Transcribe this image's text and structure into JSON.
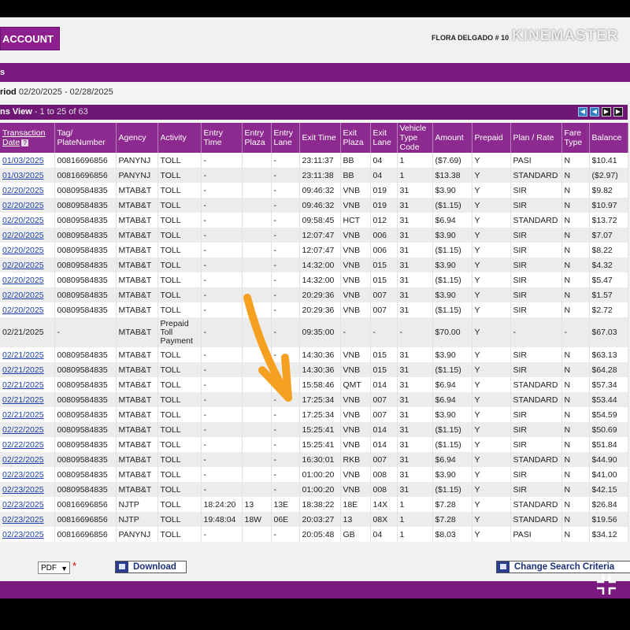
{
  "header": {
    "account_button": "ACCOUNT",
    "user": "FLORA DELGADO # 10",
    "watermark": "KINEMASTER",
    "section_title": "s",
    "period_label": "riod",
    "period_value": "02/20/2025 - 02/28/2025",
    "view_title": "ns View",
    "view_count": "- 1 to 25 of 63"
  },
  "pager_icons": [
    "first-page-icon",
    "previous-page-icon",
    "next-page-icon",
    "last-page-icon"
  ],
  "columns": [
    "Transaction Date",
    "Tag/ PlateNumber",
    "Agency",
    "Activity",
    "Entry Time",
    "Entry Plaza",
    "Entry Lane",
    "Exit Time",
    "Exit Plaza",
    "Exit Lane",
    "Vehicle Type Code",
    "Amount",
    "Prepaid",
    "Plan / Rate",
    "Fare Type",
    "Balance"
  ],
  "rows": [
    [
      "01/03/2025",
      "00816696856",
      "PANYNJ",
      "TOLL",
      "-",
      "",
      "-",
      "23:11:37",
      "BB",
      "04",
      "1",
      "($7.69)",
      "Y",
      "PASI",
      "N",
      "$10.41"
    ],
    [
      "01/03/2025",
      "00816696856",
      "PANYNJ",
      "TOLL",
      "-",
      "",
      "-",
      "23:11:38",
      "BB",
      "04",
      "1",
      "$13.38",
      "Y",
      "STANDARD",
      "N",
      "($2.97)"
    ],
    [
      "02/20/2025",
      "00809584835",
      "MTAB&T",
      "TOLL",
      "-",
      "",
      "-",
      "09:46:32",
      "VNB",
      "019",
      "31",
      "$3.90",
      "Y",
      "SIR",
      "N",
      "$9.82"
    ],
    [
      "02/20/2025",
      "00809584835",
      "MTAB&T",
      "TOLL",
      "-",
      "",
      "-",
      "09:46:32",
      "VNB",
      "019",
      "31",
      "($1.15)",
      "Y",
      "SIR",
      "N",
      "$10.97"
    ],
    [
      "02/20/2025",
      "00809584835",
      "MTAB&T",
      "TOLL",
      "-",
      "",
      "-",
      "09:58:45",
      "HCT",
      "012",
      "31",
      "$6.94",
      "Y",
      "STANDARD",
      "N",
      "$13.72"
    ],
    [
      "02/20/2025",
      "00809584835",
      "MTAB&T",
      "TOLL",
      "-",
      "",
      "-",
      "12:07:47",
      "VNB",
      "006",
      "31",
      "$3.90",
      "Y",
      "SIR",
      "N",
      "$7.07"
    ],
    [
      "02/20/2025",
      "00809584835",
      "MTAB&T",
      "TOLL",
      "-",
      "",
      "-",
      "12:07:47",
      "VNB",
      "006",
      "31",
      "($1.15)",
      "Y",
      "SIR",
      "N",
      "$8.22"
    ],
    [
      "02/20/2025",
      "00809584835",
      "MTAB&T",
      "TOLL",
      "-",
      "",
      "-",
      "14:32:00",
      "VNB",
      "015",
      "31",
      "$3.90",
      "Y",
      "SIR",
      "N",
      "$4.32"
    ],
    [
      "02/20/2025",
      "00809584835",
      "MTAB&T",
      "TOLL",
      "-",
      "",
      "-",
      "14:32:00",
      "VNB",
      "015",
      "31",
      "($1.15)",
      "Y",
      "SIR",
      "N",
      "$5.47"
    ],
    [
      "02/20/2025",
      "00809584835",
      "MTAB&T",
      "TOLL",
      "-",
      "",
      "-",
      "20:29:36",
      "VNB",
      "007",
      "31",
      "$3.90",
      "Y",
      "SIR",
      "N",
      "$1.57"
    ],
    [
      "02/20/2025",
      "00809584835",
      "MTAB&T",
      "TOLL",
      "-",
      "",
      "-",
      "20:29:36",
      "VNB",
      "007",
      "31",
      "($1.15)",
      "Y",
      "SIR",
      "N",
      "$2.72"
    ],
    [
      "02/21/2025",
      "-",
      "MTAB&T",
      "Prepaid Toll Payment",
      "-",
      "",
      "-",
      "09:35:00",
      "-",
      "-",
      "-",
      "$70.00",
      "Y",
      "-",
      "-",
      "$67.03"
    ],
    [
      "02/21/2025",
      "00809584835",
      "MTAB&T",
      "TOLL",
      "-",
      "",
      "-",
      "14:30:36",
      "VNB",
      "015",
      "31",
      "$3.90",
      "Y",
      "SIR",
      "N",
      "$63.13"
    ],
    [
      "02/21/2025",
      "00809584835",
      "MTAB&T",
      "TOLL",
      "-",
      "",
      "-",
      "14:30:36",
      "VNB",
      "015",
      "31",
      "($1.15)",
      "Y",
      "SIR",
      "N",
      "$64.28"
    ],
    [
      "02/21/2025",
      "00809584835",
      "MTAB&T",
      "TOLL",
      "-",
      "",
      "-",
      "15:58:46",
      "QMT",
      "014",
      "31",
      "$6.94",
      "Y",
      "STANDARD",
      "N",
      "$57.34"
    ],
    [
      "02/21/2025",
      "00809584835",
      "MTAB&T",
      "TOLL",
      "-",
      "",
      "-",
      "17:25:34",
      "VNB",
      "007",
      "31",
      "$6.94",
      "Y",
      "STANDARD",
      "N",
      "$53.44"
    ],
    [
      "02/21/2025",
      "00809584835",
      "MTAB&T",
      "TOLL",
      "-",
      "",
      "-",
      "17:25:34",
      "VNB",
      "007",
      "31",
      "$3.90",
      "Y",
      "SIR",
      "N",
      "$54.59"
    ],
    [
      "02/22/2025",
      "00809584835",
      "MTAB&T",
      "TOLL",
      "-",
      "",
      "-",
      "15:25:41",
      "VNB",
      "014",
      "31",
      "($1.15)",
      "Y",
      "SIR",
      "N",
      "$50.69"
    ],
    [
      "02/22/2025",
      "00809584835",
      "MTAB&T",
      "TOLL",
      "-",
      "",
      "-",
      "15:25:41",
      "VNB",
      "014",
      "31",
      "($1.15)",
      "Y",
      "SIR",
      "N",
      "$51.84"
    ],
    [
      "02/22/2025",
      "00809584835",
      "MTAB&T",
      "TOLL",
      "-",
      "",
      "-",
      "16:30:01",
      "RKB",
      "007",
      "31",
      "$6.94",
      "Y",
      "STANDARD",
      "N",
      "$44.90"
    ],
    [
      "02/23/2025",
      "00809584835",
      "MTAB&T",
      "TOLL",
      "-",
      "",
      "-",
      "01:00:20",
      "VNB",
      "008",
      "31",
      "$3.90",
      "Y",
      "SIR",
      "N",
      "$41.00"
    ],
    [
      "02/23/2025",
      "00809584835",
      "MTAB&T",
      "TOLL",
      "-",
      "",
      "-",
      "01:00:20",
      "VNB",
      "008",
      "31",
      "($1.15)",
      "Y",
      "SIR",
      "N",
      "$42.15"
    ],
    [
      "02/23/2025",
      "00816696856",
      "NJTP",
      "TOLL",
      "18:24:20",
      "13",
      "13E",
      "18:38:22",
      "18E",
      "14X",
      "1",
      "$7.28",
      "Y",
      "STANDARD",
      "N",
      "$26.84"
    ],
    [
      "02/23/2025",
      "00816696856",
      "NJTP",
      "TOLL",
      "19:48:04",
      "18W",
      "06E",
      "20:03:27",
      "13",
      "08X",
      "1",
      "$7.28",
      "Y",
      "STANDARD",
      "N",
      "$19.56"
    ],
    [
      "02/23/2025",
      "00816696856",
      "PANYNJ",
      "TOLL",
      "-",
      "",
      "-",
      "20:05:48",
      "GB",
      "04",
      "1",
      "$8.03",
      "Y",
      "PASI",
      "N",
      "$34.12"
    ]
  ],
  "footer": {
    "format_value": "PDF",
    "required_mark": "*",
    "download_label": "Download",
    "change_search_label": "Change Search Criteria"
  },
  "colors": {
    "brand_purple": "#7a1a7f",
    "header_purple": "#8d2a8f",
    "link_blue": "#1a3fa6",
    "arrow_orange": "#f5a020"
  }
}
